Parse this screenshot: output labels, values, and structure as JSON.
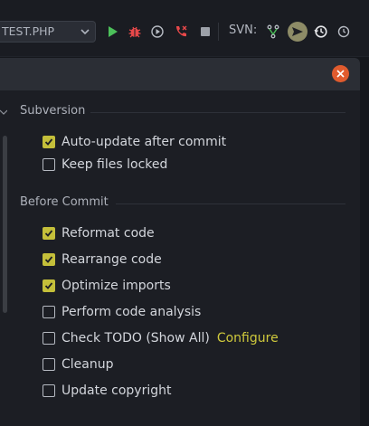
{
  "toolbar": {
    "run_config": "TEST.PHP",
    "svn_label": "SVN:",
    "icons": [
      "chevron-down-icon",
      "run-icon",
      "debug-icon",
      "run-with-coverage-icon",
      "phone-hangup-icon",
      "stop-icon",
      "svn-branch-icon",
      "svn-commit-icon",
      "history-icon",
      "revert-icon"
    ]
  },
  "dialog": {
    "close_icon": "close-icon",
    "accent": "#c4bf3a",
    "subversion": {
      "title": "Subversion",
      "options": [
        {
          "label": "Auto-update after commit",
          "checked": true,
          "mnemonic": ""
        },
        {
          "label": "Keep files locked",
          "checked": false,
          "mnemonic": "K"
        }
      ]
    },
    "before_commit": {
      "title": "Before Commit",
      "options": [
        {
          "label": "Reformat code",
          "checked": true
        },
        {
          "label": "Rearrange code",
          "checked": true
        },
        {
          "label": "Optimize imports",
          "checked": true
        },
        {
          "label": "Perform code analysis",
          "checked": false
        },
        {
          "label": "Check TODO (Show All)",
          "checked": false,
          "link": "Configure"
        },
        {
          "label": "Cleanup",
          "checked": false
        },
        {
          "label": "Update copyright",
          "checked": false
        }
      ]
    }
  }
}
